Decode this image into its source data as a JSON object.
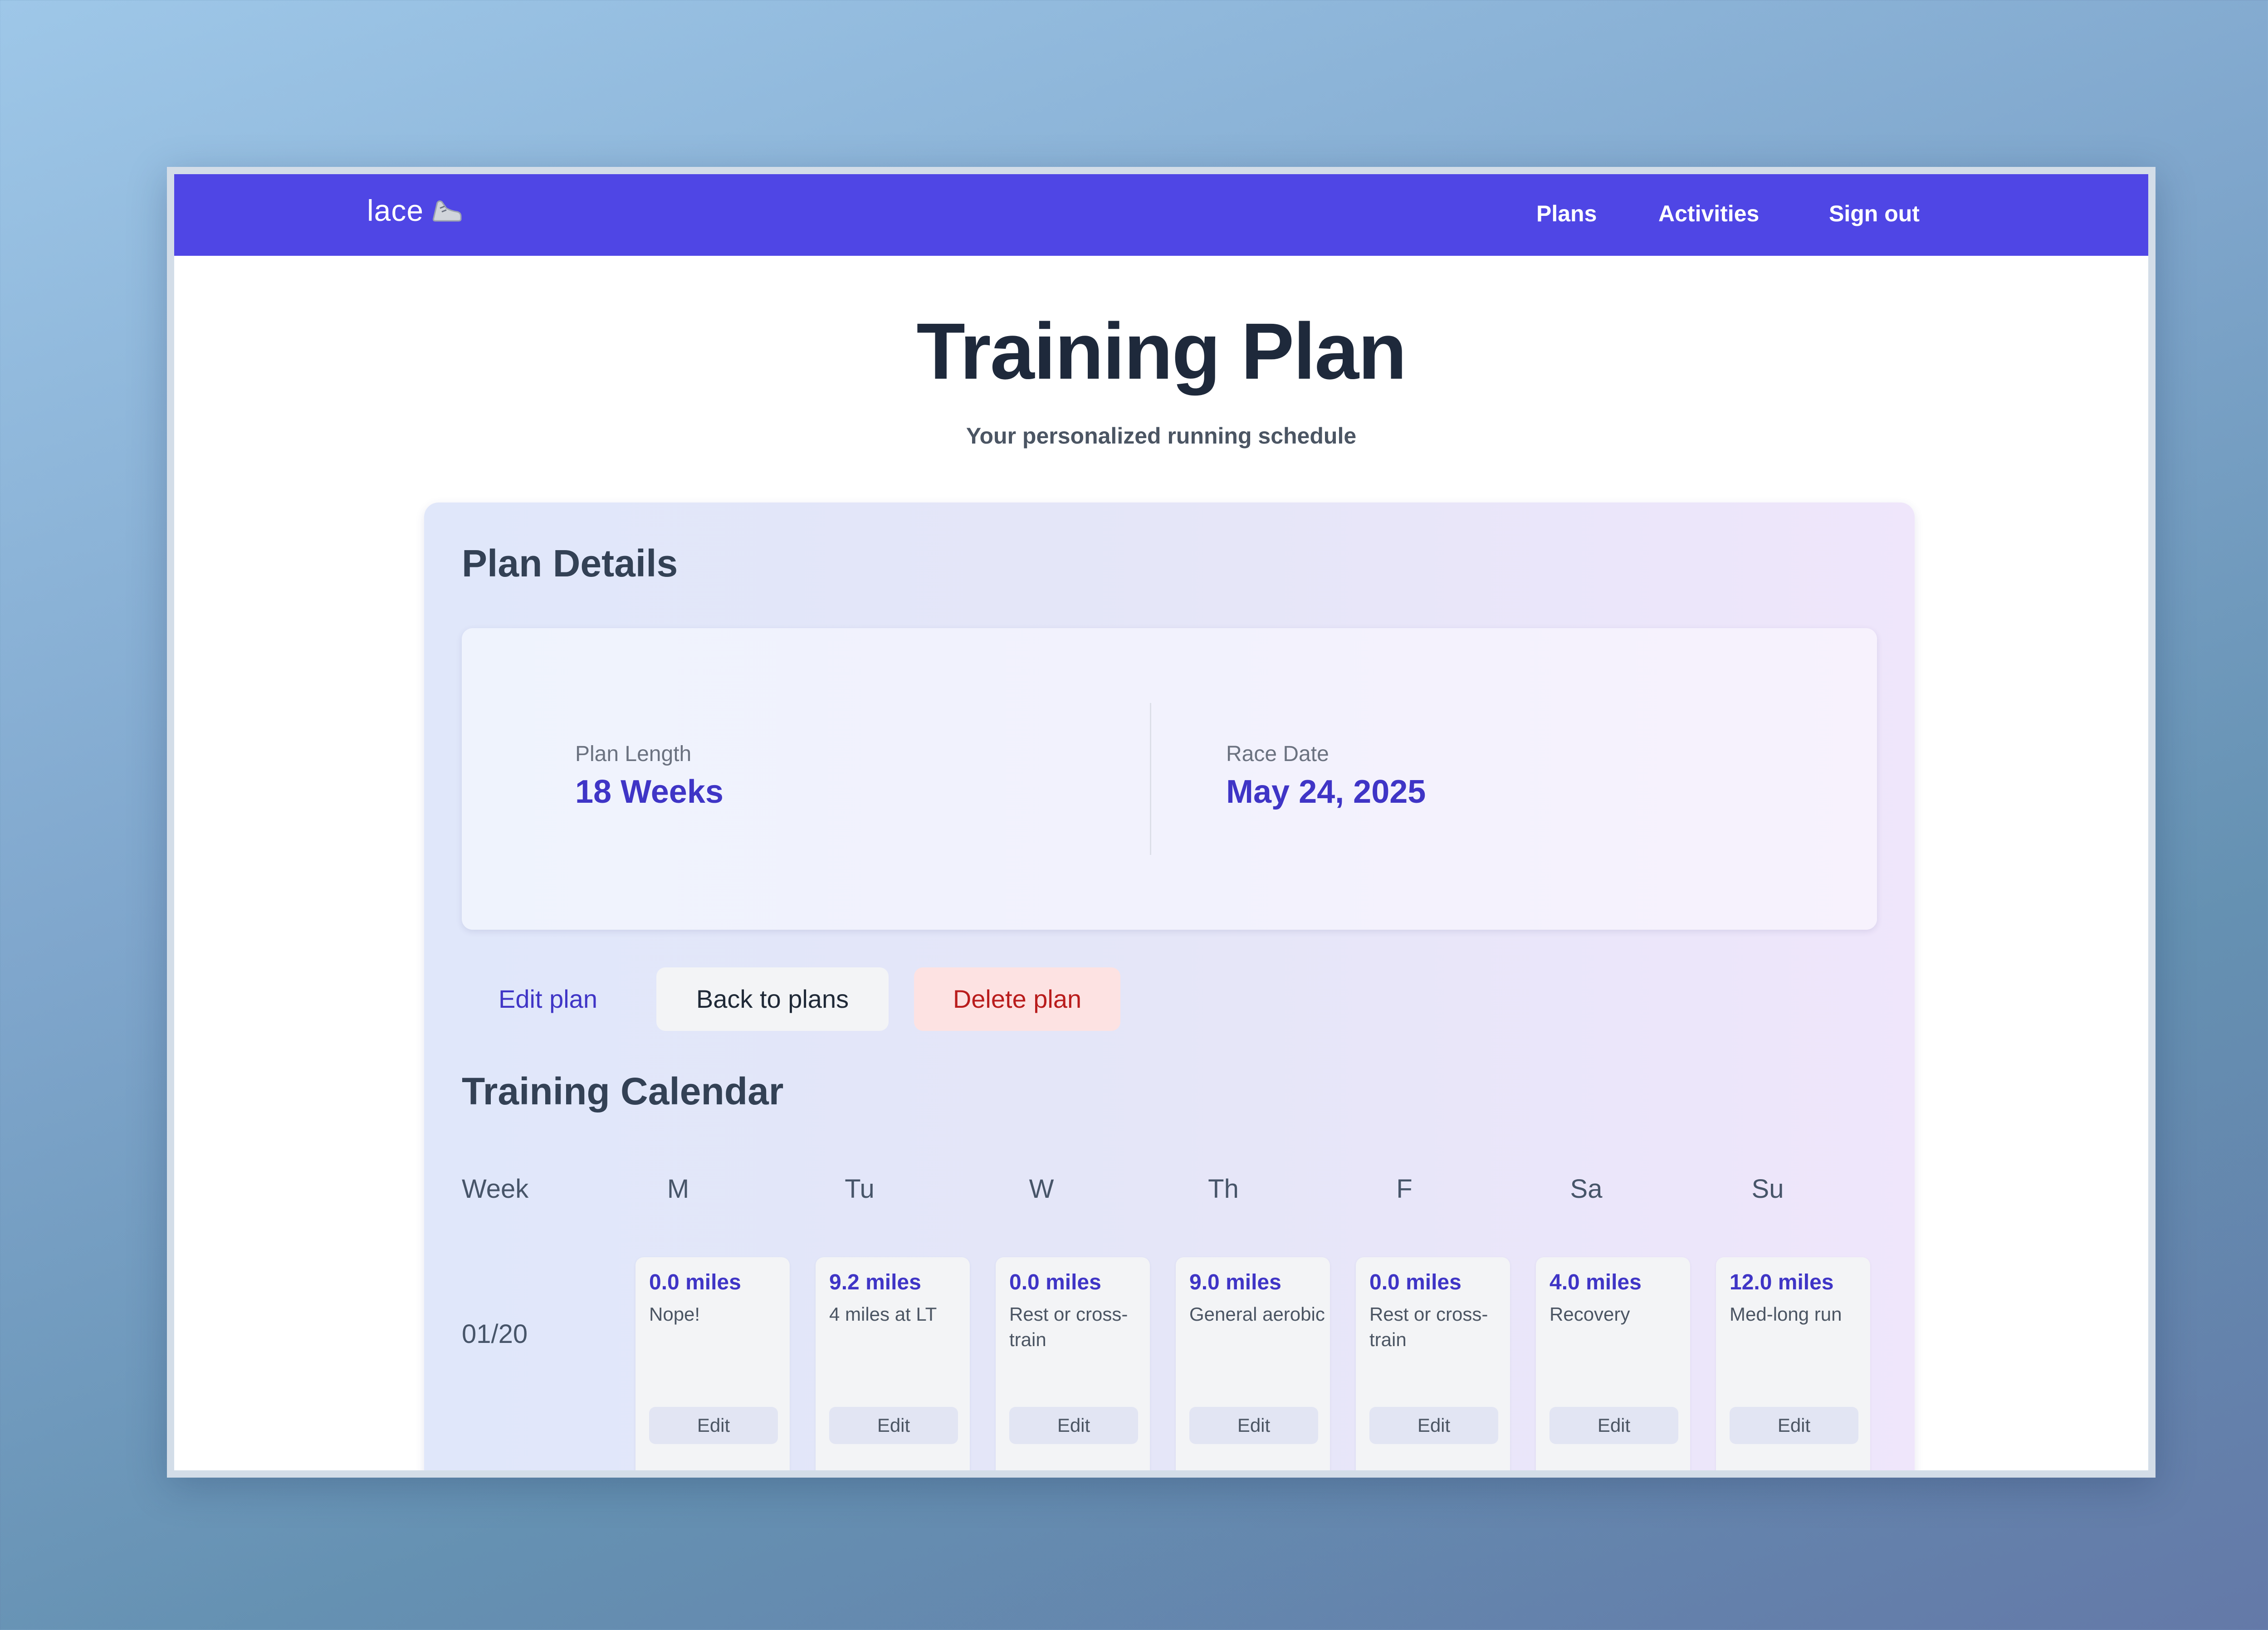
{
  "nav": {
    "brand": "lace",
    "brand_icon": "running-shoe-icon",
    "links": [
      "Plans",
      "Activities",
      "Sign out"
    ],
    "accent": "#4f46e5"
  },
  "header": {
    "title": "Training Plan",
    "subtitle": "Your personalized running schedule"
  },
  "plan_details": {
    "heading": "Plan Details",
    "length_label": "Plan Length",
    "length_value": "18 Weeks",
    "race_label": "Race Date",
    "race_value": "May 24, 2025"
  },
  "actions": {
    "edit": "Edit plan",
    "back": "Back to plans",
    "delete": "Delete plan"
  },
  "calendar": {
    "heading": "Training Calendar",
    "week_header": "Week",
    "days": [
      "M",
      "Tu",
      "W",
      "Th",
      "F",
      "Sa",
      "Su"
    ],
    "weeks": [
      {
        "label": "01/20",
        "entries": [
          {
            "miles": "0.0 miles",
            "desc": "Nope!",
            "edit": "Edit"
          },
          {
            "miles": "9.2 miles",
            "desc": "4 miles at LT",
            "edit": "Edit"
          },
          {
            "miles": "0.0 miles",
            "desc": "Rest or cross-train",
            "edit": "Edit"
          },
          {
            "miles": "9.0 miles",
            "desc": "General aerobic",
            "edit": "Edit"
          },
          {
            "miles": "0.0 miles",
            "desc": "Rest or cross-train",
            "edit": "Edit"
          },
          {
            "miles": "4.0 miles",
            "desc": "Recovery",
            "edit": "Edit"
          },
          {
            "miles": "12.0 miles",
            "desc": "Med-long run",
            "edit": "Edit"
          }
        ]
      }
    ]
  }
}
